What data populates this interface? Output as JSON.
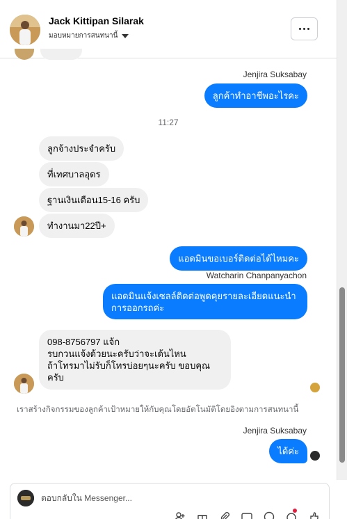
{
  "header": {
    "name": "Jack Kittipan Silarak",
    "subtitle": "มอบหมายการสนทนานี้"
  },
  "messages": {
    "sender_1": "Jenjira Suksabay",
    "out_1": "ลูกค้าทำอาชีพอะไรคะ",
    "time_1": "11:27",
    "in_1": "ลูกจ้างประจำครับ",
    "in_2": "ที่เทศบาลอุดร",
    "in_3": "ฐานเงินเดือน15-16 ครับ",
    "in_4": "ทำงานมา22ปี+",
    "out_2": "แอดมินขอเบอร์ติดต่อได้ไหมคะ",
    "sender_2": "Watcharin Chanpanyachon",
    "out_3": "แอดมินแจ้งเซลล์ติดต่อพูดคุยรายละเอียดแนะนำการออกรถค่ะ",
    "in_5": "098-8756797 แจ้ก\nรบกวนแจ้งด้วยนะครับว่าจะเด้นไหน\nถ้าโทรมาไม่รับก็โทรบ่อยๆนะครับ ขอบคุณครับ",
    "notice": "เราสร้างกิจกรรมของลูกค้าเป้าหมายให้กับคุณโดยอัตโนมัติโดยอิงตามการสนทนานี้",
    "sender_3": "Jenjira Suksabay",
    "out_4": "ได้ค่ะ"
  },
  "composer": {
    "placeholder": "ตอบกลับใน Messenger..."
  },
  "icons": [
    "more-options-icon",
    "chevron-down-icon",
    "add-person-icon",
    "gift-icon",
    "attach-icon",
    "gif-icon",
    "emoji-icon",
    "sticker-icon",
    "like-icon"
  ],
  "colors": {
    "outgoing_bubble": "#0a7cff",
    "incoming_bubble": "#f0f0f0"
  }
}
